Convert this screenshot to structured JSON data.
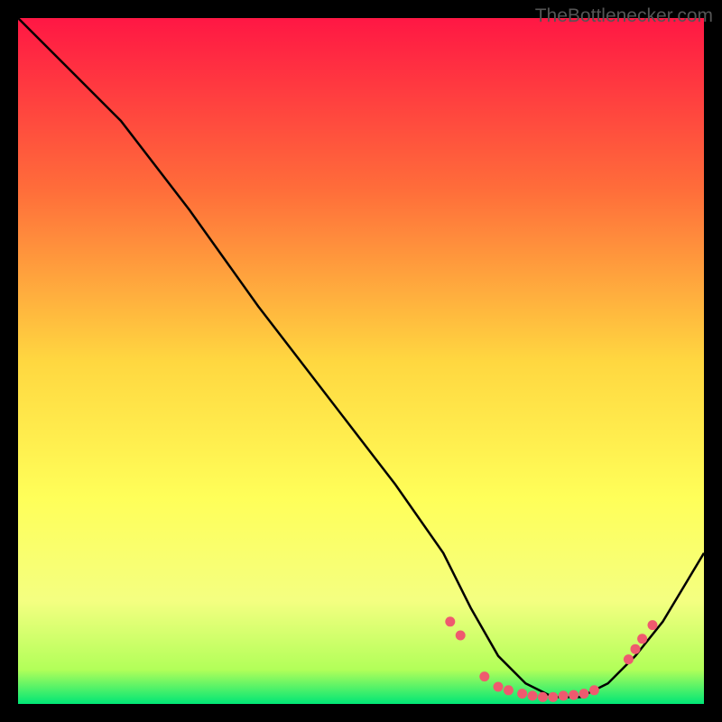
{
  "watermark": "TheBottlenecker.com",
  "chart_data": {
    "type": "line",
    "title": "",
    "xlabel": "",
    "ylabel": "",
    "xlim": [
      0,
      100
    ],
    "ylim": [
      0,
      100
    ],
    "gradient_stops": [
      {
        "offset": 0,
        "color": "#ff1744"
      },
      {
        "offset": 25,
        "color": "#ff6d3a"
      },
      {
        "offset": 50,
        "color": "#ffd740"
      },
      {
        "offset": 70,
        "color": "#ffff59"
      },
      {
        "offset": 85,
        "color": "#f4ff81"
      },
      {
        "offset": 95,
        "color": "#b2ff59"
      },
      {
        "offset": 100,
        "color": "#00e676"
      }
    ],
    "series": [
      {
        "name": "bottleneck-curve",
        "color": "#000000",
        "x": [
          0,
          8,
          15,
          25,
          35,
          45,
          55,
          62,
          66,
          70,
          74,
          78,
          82,
          86,
          90,
          94,
          100
        ],
        "y": [
          100,
          92,
          85,
          72,
          58,
          45,
          32,
          22,
          14,
          7,
          3,
          1,
          1,
          3,
          7,
          12,
          22
        ]
      }
    ],
    "markers": {
      "name": "data-points",
      "color": "#ef5a6f",
      "radius": 5.5,
      "points": [
        {
          "x": 63,
          "y": 12
        },
        {
          "x": 64.5,
          "y": 10
        },
        {
          "x": 68,
          "y": 4
        },
        {
          "x": 70,
          "y": 2.5
        },
        {
          "x": 71.5,
          "y": 2
        },
        {
          "x": 73.5,
          "y": 1.5
        },
        {
          "x": 75,
          "y": 1.2
        },
        {
          "x": 76.5,
          "y": 1
        },
        {
          "x": 78,
          "y": 1
        },
        {
          "x": 79.5,
          "y": 1.2
        },
        {
          "x": 81,
          "y": 1.3
        },
        {
          "x": 82.5,
          "y": 1.5
        },
        {
          "x": 84,
          "y": 2
        },
        {
          "x": 89,
          "y": 6.5
        },
        {
          "x": 90,
          "y": 8
        },
        {
          "x": 91,
          "y": 9.5
        },
        {
          "x": 92.5,
          "y": 11.5
        }
      ]
    }
  }
}
